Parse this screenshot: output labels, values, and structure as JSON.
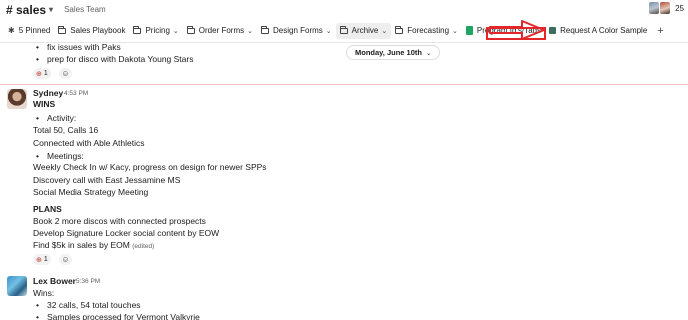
{
  "header": {
    "channel": "# sales",
    "topic": "Sales Team",
    "member_count": "25"
  },
  "tabs": [
    {
      "label": "5 Pinned",
      "icon": "pin-icon"
    },
    {
      "label": "Sales Playbook",
      "icon": "folder-icon"
    },
    {
      "label": "Pricing",
      "icon": "folder-icon"
    },
    {
      "label": "Order Forms",
      "icon": "folder-icon"
    },
    {
      "label": "Design Forms",
      "icon": "folder-icon"
    },
    {
      "label": "Archive",
      "icon": "folder-icon"
    },
    {
      "label": "Forecasting",
      "icon": "folder-icon"
    },
    {
      "label": "Program Id's/Tags",
      "icon": "sheets-icon"
    },
    {
      "label": "Request A Color Sample",
      "icon": "slides-icon"
    },
    {
      "label": "+",
      "icon": "add-icon"
    }
  ],
  "date_divider": "Monday, June 10th",
  "previous_message": {
    "bullets": [
      "fix issues with Paks",
      "prep for disco with Dakota Young Stars"
    ],
    "reaction_count": "1"
  },
  "message_sydney": {
    "author": "Sydney",
    "time": "4:53 PM",
    "wins_heading": "WINS",
    "activity_bullet": "Activity:",
    "activity_lines": [
      "Total 50, Calls 16",
      "Connected with Able Athletics"
    ],
    "meetings_bullet": "Meetings:",
    "meeting_lines": [
      "Weekly Check In w/ Kacy, progress on design for newer SPPs",
      "Discovery call with East Jessamine MS",
      "Social Media Strategy Meeting"
    ],
    "plans_heading": "PLANS",
    "plan_lines": [
      "Book 2 more discos with connected prospects",
      "Develop Signature Locker social content by EOW",
      "Find $5k in sales by EOM"
    ],
    "edited": "(edited)",
    "reaction_count": "1"
  },
  "message_lex": {
    "author": "Lex Bower",
    "time": "5:36 PM",
    "intro": "Wins:",
    "bullets": [
      "32 calls, 54 total touches",
      "Samples processed for Vermont Valkyrie"
    ]
  },
  "colors": {
    "annotation": "#e3262a",
    "divider": "#f0c4c4",
    "text": "#1d1c1d"
  }
}
